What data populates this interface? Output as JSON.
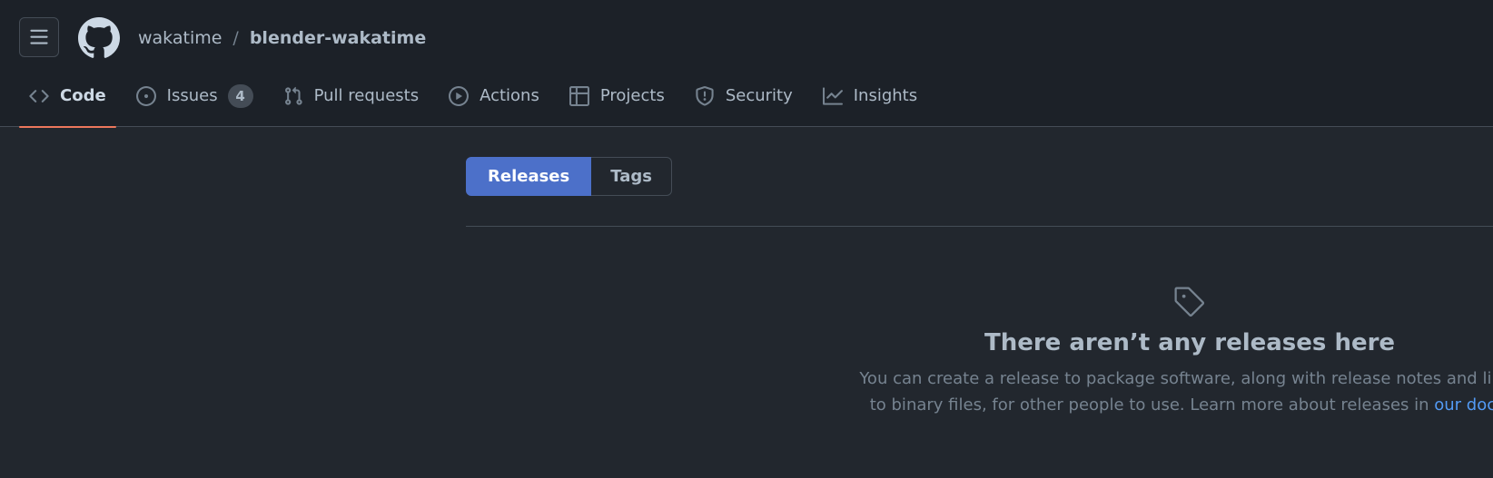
{
  "header": {
    "owner": "wakatime",
    "separator": "/",
    "repo": "blender-wakatime"
  },
  "nav": {
    "tabs": [
      {
        "label": "Code",
        "icon": "code-icon",
        "active": true
      },
      {
        "label": "Issues",
        "icon": "issue-opened-icon",
        "count": "4"
      },
      {
        "label": "Pull requests",
        "icon": "git-pull-request-icon"
      },
      {
        "label": "Actions",
        "icon": "play-icon"
      },
      {
        "label": "Projects",
        "icon": "table-icon"
      },
      {
        "label": "Security",
        "icon": "shield-icon"
      },
      {
        "label": "Insights",
        "icon": "graph-icon"
      }
    ]
  },
  "subnav": {
    "releases": "Releases",
    "tags": "Tags"
  },
  "blankslate": {
    "icon": "tag-icon",
    "title": "There aren’t any releases here",
    "description": "You can create a release to package software, along with release notes and links to binary files, for other people to use. Learn more about releases in ",
    "link_text": "our docs",
    "trailing": "."
  },
  "colors": {
    "background": "#22272e",
    "header_background": "#1c2128",
    "border": "#444c56",
    "active_underline": "#ec775c",
    "primary_button": "#4c70c9",
    "link": "#539bf5"
  }
}
